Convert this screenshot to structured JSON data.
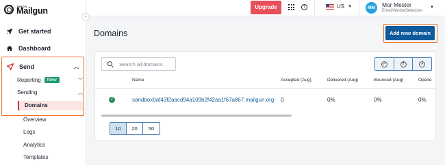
{
  "brand": {
    "sinch": "SINCH",
    "name": "Mailgun"
  },
  "sidebar": {
    "collapse": "‹",
    "get_started": "Get started",
    "dashboard": "Dashboard",
    "send": "Send",
    "reporting": "Reporting",
    "reporting_badge": "New",
    "sending": "Sending",
    "domains": "Domains",
    "overview": "Overview",
    "logs": "Logs",
    "analytics": "Analytics",
    "templates": "Templates"
  },
  "topbar": {
    "upgrade": "Upgrade",
    "region": "US",
    "user_initials": "MM",
    "user_name": "Mor Mester",
    "user_org": "EmailVendorSelection"
  },
  "main": {
    "title": "Domains",
    "add_button": "Add new domain",
    "search_placeholder": "Search all domains",
    "columns": [
      "Name",
      "Accepted (Aug)",
      "Delivered (Aug)",
      "Bounced (Aug)",
      "Opene"
    ],
    "rows": [
      {
        "name": "sandbox0af43f2aacd94a109b2f42aa1f67a867.mailgun.org",
        "accepted": "0",
        "delivered": "0%",
        "bounced": "0%",
        "opened": "0%"
      }
    ],
    "page_sizes": [
      "10",
      "20",
      "50"
    ],
    "active_page_size": "10"
  },
  "colors": {
    "accent": "#0f5a9c",
    "upgrade": "#e8505b",
    "highlight": "#e8702a",
    "active_bg": "#fbe4e4",
    "active_bar": "#d0303b",
    "badge": "#1e9b6a",
    "avatar": "#29a3de",
    "link": "#1a5e99"
  }
}
